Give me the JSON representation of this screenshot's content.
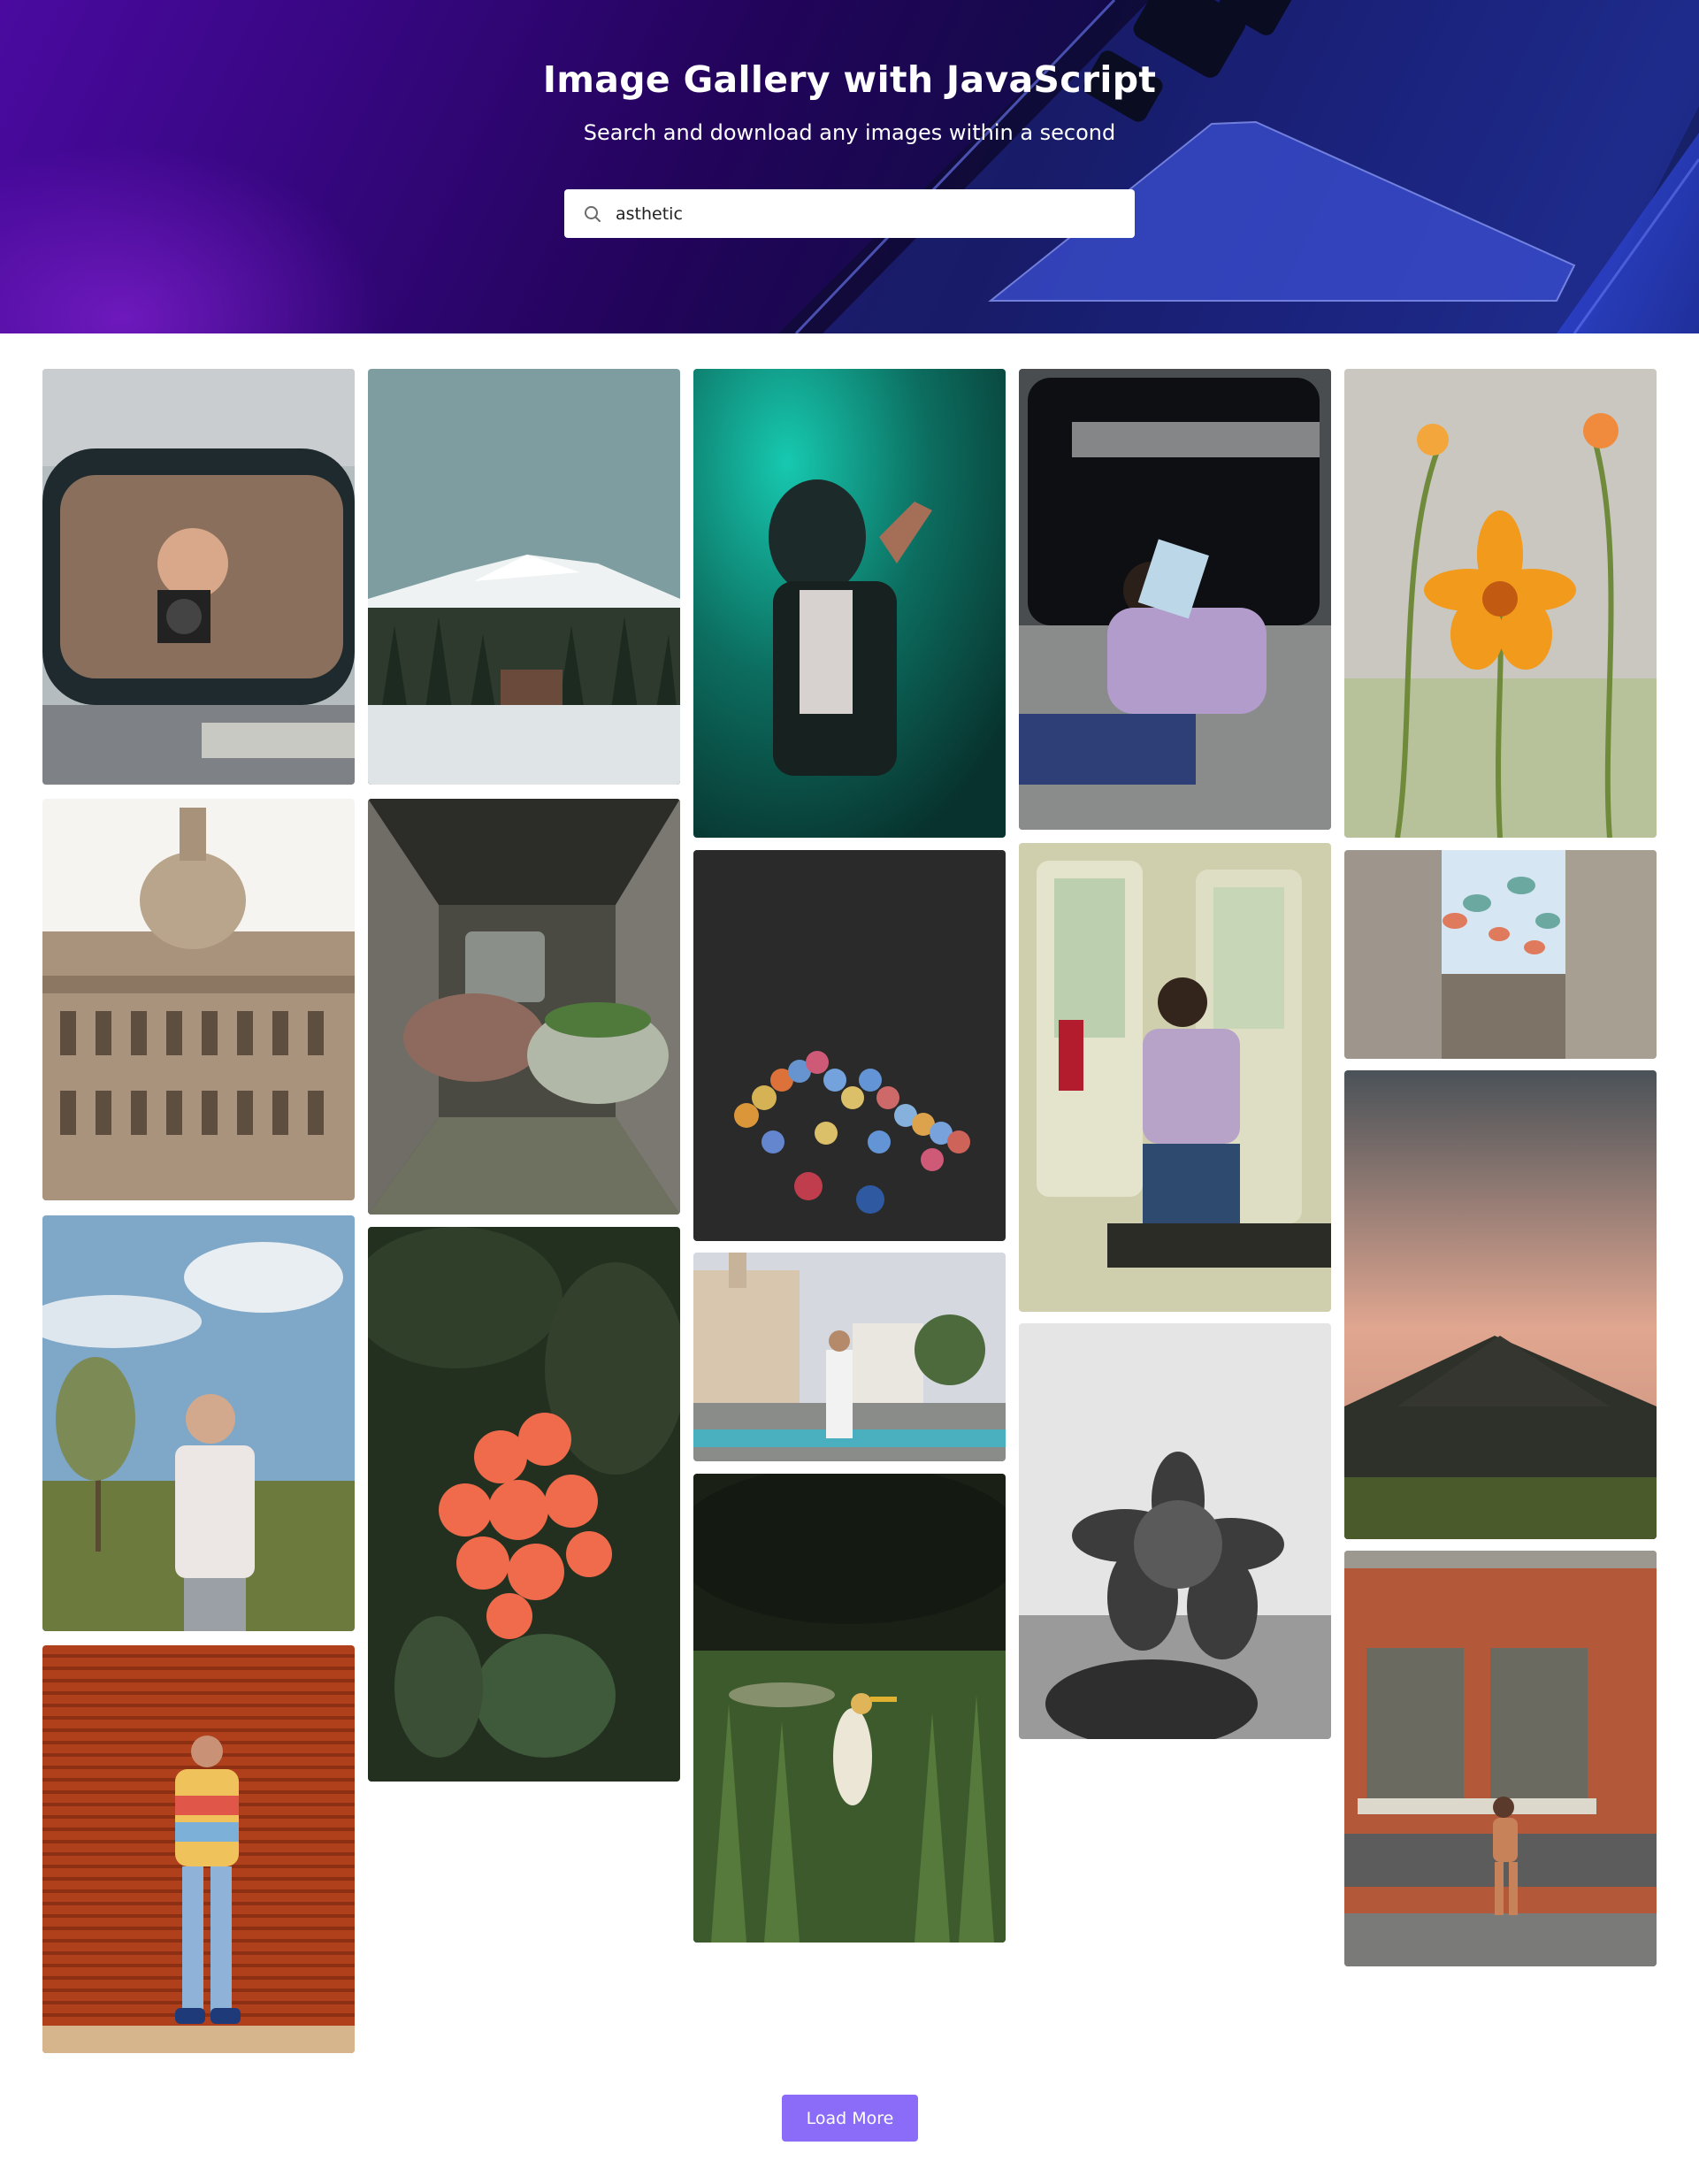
{
  "header": {
    "title": "Image Gallery with JavaScript",
    "subtitle": "Search and download any images within a second"
  },
  "search": {
    "icon": "search-icon",
    "value": "asthetic",
    "placeholder": ""
  },
  "colors": {
    "accent": "#8a6cf8",
    "hero_start": "#4a0aa0",
    "hero_end": "#2a3fc0"
  },
  "gallery": {
    "photos": [
      "Man taking a photo in a car side mirror",
      "Snowy mountain above a pine forest",
      "Person in a hood against a teal background",
      "Woman reading a book on a train",
      "Orange cosmos flower",
      "Capitol building dome",
      "Abandoned cars in a tunnel",
      "Bokeh city lights",
      "Woman reading on a metro",
      "Street with hanging lanterns",
      "Man in a patterned shirt by trees",
      "Red ixora flower cluster",
      "Man at a market square",
      "Sunset over a mountain",
      "Woman against an orange shutter",
      "Egret in tall grass",
      "Black and white flower in hand",
      "Woman walking by a brick wall"
    ]
  },
  "actions": {
    "load_more_label": "Load More"
  }
}
